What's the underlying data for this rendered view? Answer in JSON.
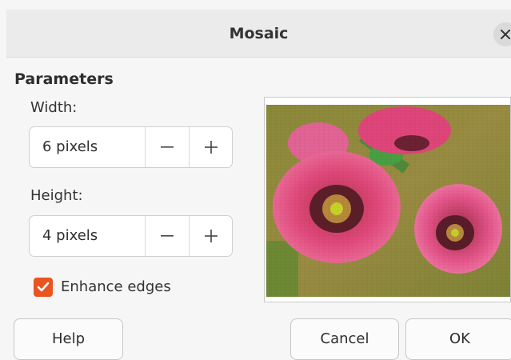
{
  "dialog": {
    "title": "Mosaic"
  },
  "parameters": {
    "heading": "Parameters",
    "width": {
      "label": "Width:",
      "value": "6 pixels"
    },
    "height": {
      "label": "Height:",
      "value": "4 pixels"
    },
    "enhance_edges": {
      "label": "Enhance edges",
      "checked": true
    }
  },
  "buttons": {
    "help": "Help",
    "cancel": "Cancel",
    "ok": "OK"
  },
  "colors": {
    "accent": "#e95420",
    "petal": "#e24a7c",
    "foliage": "#7a8a3a"
  },
  "icons": {
    "close": "close-icon",
    "minus": "minus-icon",
    "plus": "plus-icon",
    "check": "checkmark-icon"
  }
}
